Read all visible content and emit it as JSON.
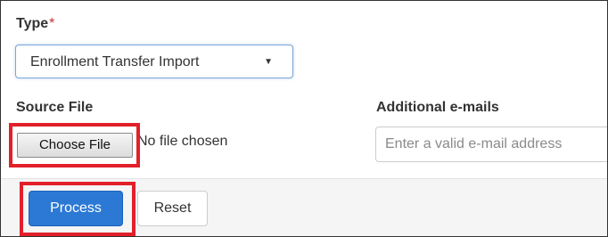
{
  "form": {
    "type_label": "Type",
    "type_required_mark": "*",
    "type_selected": "Enrollment Transfer Import",
    "type_caret": "▼",
    "source_file_label": "Source File",
    "choose_file_label": "Choose File",
    "no_file_text": "No file chosen",
    "additional_emails_label": "Additional e-mails",
    "email_placeholder": "Enter a valid e-mail address"
  },
  "actions": {
    "process_label": "Process",
    "reset_label": "Reset"
  },
  "colors": {
    "required": "#c9302c",
    "primary": "#2b79d4",
    "highlight": "#e2202a",
    "action_bar": "#f5f5f5"
  }
}
